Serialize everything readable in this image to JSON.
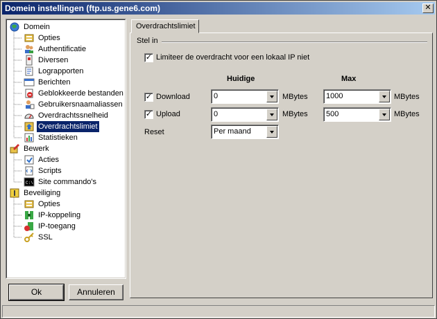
{
  "window": {
    "title": "Domein instellingen (ftp.us.gene6.com)",
    "close_glyph": "✕"
  },
  "tree": {
    "groups": [
      {
        "label": "Domein",
        "icon": "globe-icon",
        "children": [
          {
            "label": "Opties",
            "icon": "options-icon"
          },
          {
            "label": "Authentificatie",
            "icon": "users-icon"
          },
          {
            "label": "Diversen",
            "icon": "misc-icon"
          },
          {
            "label": "Lograpporten",
            "icon": "log-icon"
          },
          {
            "label": "Berichten",
            "icon": "message-icon"
          },
          {
            "label": "Geblokkeerde bestanden",
            "icon": "blocked-icon"
          },
          {
            "label": "Gebruikersnaamaliassen",
            "icon": "alias-icon"
          },
          {
            "label": "Overdrachtssnelheid",
            "icon": "speed-icon"
          },
          {
            "label": "Overdrachtslimiet",
            "icon": "limit-icon",
            "selected": true
          },
          {
            "label": "Statistieken",
            "icon": "stats-icon"
          }
        ]
      },
      {
        "label": "Bewerk",
        "icon": "edit-icon",
        "children": [
          {
            "label": "Acties",
            "icon": "actions-icon"
          },
          {
            "label": "Scripts",
            "icon": "scripts-icon"
          },
          {
            "label": "Site commando's",
            "icon": "console-icon"
          }
        ]
      },
      {
        "label": "Beveiliging",
        "icon": "lock-icon",
        "children": [
          {
            "label": "Opties",
            "icon": "options-icon"
          },
          {
            "label": "IP-koppeling",
            "icon": "ip-binding-icon"
          },
          {
            "label": "IP-toegang",
            "icon": "ip-access-icon"
          },
          {
            "label": "SSL",
            "icon": "key-icon"
          }
        ]
      }
    ]
  },
  "buttons": {
    "ok": "Ok",
    "cancel": "Annuleren"
  },
  "tab": {
    "label": "Overdrachtslimiet"
  },
  "group": {
    "label": "Stel in"
  },
  "limit_local_ip": {
    "label": "Limiteer de overdracht voor een lokaal IP niet",
    "checked": true
  },
  "headers": {
    "current": "Huidige",
    "max": "Max"
  },
  "download": {
    "label": "Download",
    "checked": true,
    "current": "0",
    "current_unit": "MBytes",
    "max": "1000",
    "max_unit": "MBytes"
  },
  "upload": {
    "label": "Upload",
    "checked": true,
    "current": "0",
    "current_unit": "MBytes",
    "max": "500",
    "max_unit": "MBytes"
  },
  "reset": {
    "label": "Reset",
    "value": "Per maand"
  },
  "check_glyph": "✓"
}
